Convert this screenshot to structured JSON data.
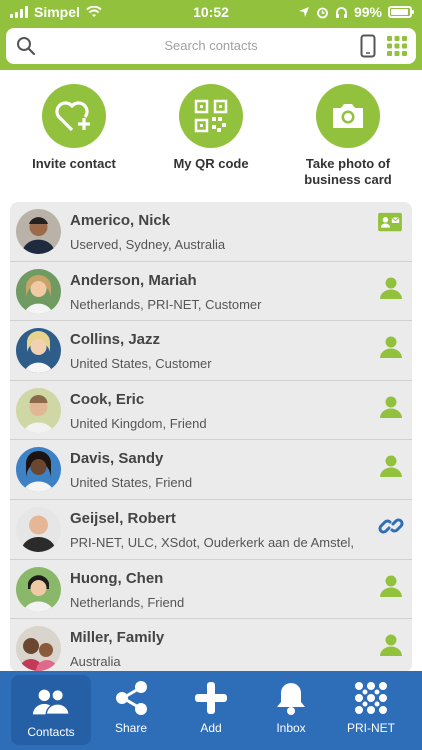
{
  "status": {
    "carrier": "Simpel",
    "time": "10:52",
    "battery": "99%"
  },
  "search": {
    "placeholder": "Search contacts"
  },
  "actions": [
    {
      "label": "Invite contact",
      "icon": "heart-plus-icon"
    },
    {
      "label": "My QR code",
      "icon": "qr-code-icon"
    },
    {
      "label": "Take photo of business card",
      "icon": "camera-icon"
    }
  ],
  "contacts": [
    {
      "name": "Americo, Nick",
      "detail": "Userved, Sydney, Australia",
      "icon": "contact-card-icon"
    },
    {
      "name": "Anderson, Mariah",
      "detail": "Netherlands, PRI-NET, Customer",
      "icon": "person-icon"
    },
    {
      "name": "Collins, Jazz",
      "detail": "United States, Customer",
      "icon": "person-icon"
    },
    {
      "name": "Cook, Eric",
      "detail": "United Kingdom, Friend",
      "icon": "person-icon"
    },
    {
      "name": "Davis, Sandy",
      "detail": "United States, Friend",
      "icon": "person-icon"
    },
    {
      "name": "Geijsel, Robert",
      "detail": "PRI-NET, ULC, XSdot, Ouderkerk aan de Amstel,",
      "icon": "link-icon"
    },
    {
      "name": "Huong, Chen",
      "detail": "Netherlands, Friend",
      "icon": "person-icon"
    },
    {
      "name": "Miller, Family",
      "detail": "Australia",
      "icon": "person-icon"
    }
  ],
  "tabs": [
    {
      "label": "Contacts",
      "icon": "contacts-icon",
      "active": true
    },
    {
      "label": "Share",
      "icon": "share-icon"
    },
    {
      "label": "Add",
      "icon": "add-icon"
    },
    {
      "label": "Inbox",
      "icon": "bell-icon"
    },
    {
      "label": "PRI-NET",
      "icon": "pri-net-icon"
    }
  ],
  "colors": {
    "brand_green": "#92c23d",
    "tab_blue": "#2e6db8",
    "link_blue": "#2e6db8"
  }
}
